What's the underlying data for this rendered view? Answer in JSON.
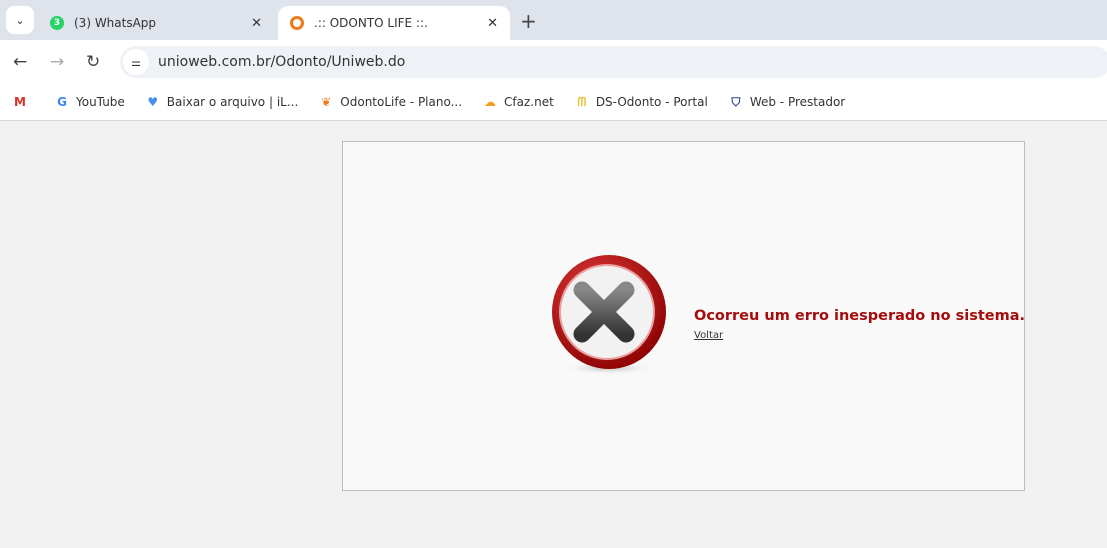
{
  "browser": {
    "tabs": [
      {
        "title": "(3) WhatsApp",
        "badge": "3",
        "active": false
      },
      {
        "title": ".:: ODONTO LIFE ::.",
        "active": true
      }
    ],
    "url": "unioweb.com.br/Odonto/Uniweb.do",
    "bookmarks": [
      {
        "label": "",
        "icon": "gmail-icon"
      },
      {
        "label": "YouTube",
        "icon": "google-icon"
      },
      {
        "label": "Baixar o arquivo | iL...",
        "icon": "heart-icon"
      },
      {
        "label": "OdontoLife - Plano...",
        "icon": "odontolife-icon"
      },
      {
        "label": "Cfaz.net",
        "icon": "cloud-icon"
      },
      {
        "label": "DS-Odonto - Portal",
        "icon": "tooth-icon"
      },
      {
        "label": "Web - Prestador",
        "icon": "shield-tooth-icon"
      }
    ]
  },
  "page": {
    "error_message": "Ocorreu um erro inesperado no sistema.",
    "back_link": "Voltar"
  },
  "colors": {
    "error": "#a50d0d"
  }
}
